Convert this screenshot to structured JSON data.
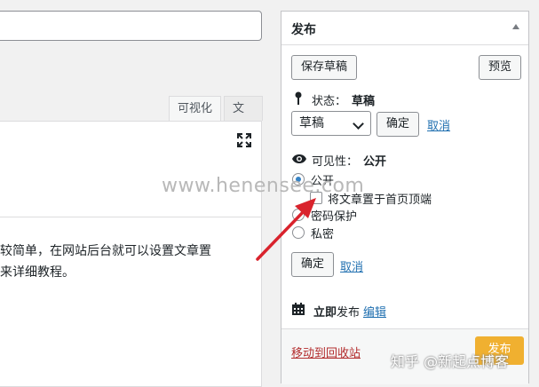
{
  "editor": {
    "tabs": [
      {
        "label": "可视化"
      },
      {
        "label": "文本"
      }
    ],
    "content_lines": [
      "较简单，在网站后台就可以设置文章置",
      "来详细教程。"
    ]
  },
  "publish": {
    "title": "发布",
    "save_draft": "保存草稿",
    "preview": "预览",
    "status_label": "状态：",
    "status_value": "草稿",
    "status_select_value": "草稿",
    "confirm": "确定",
    "cancel": "取消",
    "visibility_label": "可见性：",
    "visibility_value": "公开",
    "options": {
      "public": "公开",
      "sticky": "将文章置于首页顶端",
      "password": "密码保护",
      "private": "私密"
    },
    "confirm2": "确定",
    "cancel2": "取消",
    "publish_time_bold": "立即",
    "publish_time_rest": "发布",
    "edit": "编辑",
    "trash": "移动到回收站",
    "publish_button": "发布"
  },
  "watermark": "www.henensee.com",
  "corner_watermark": "知乎 @新起点博客",
  "colors": {
    "link": "#2271b1",
    "trash": "#b32d2e",
    "publish_button": "#f0b030",
    "arrow": "#d9232d"
  }
}
